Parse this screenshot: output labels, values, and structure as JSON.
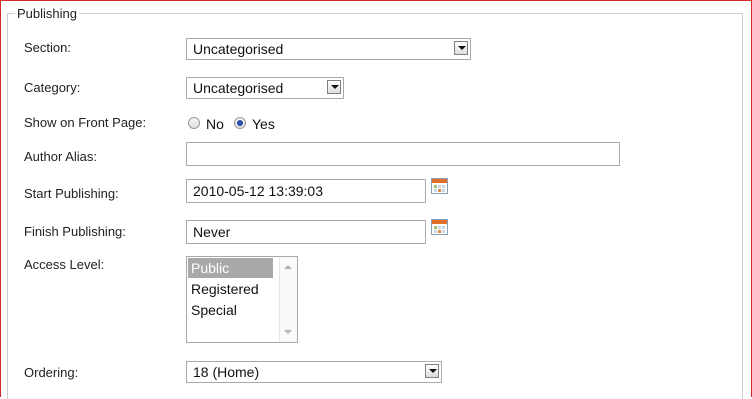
{
  "fieldset": {
    "legend": "Publishing"
  },
  "fields": {
    "section": {
      "label": "Section:",
      "value": "Uncategorised"
    },
    "category": {
      "label": "Category:",
      "value": "Uncategorised"
    },
    "front_page": {
      "label": "Show on Front Page:",
      "options": [
        "No",
        "Yes"
      ],
      "selected": "Yes"
    },
    "author_alias": {
      "label": "Author Alias:",
      "value": ""
    },
    "start_publishing": {
      "label": "Start Publishing:",
      "value": "2010-05-12 13:39:03"
    },
    "finish_publishing": {
      "label": "Finish Publishing:",
      "value": "Never"
    },
    "access_level": {
      "label": "Access Level:",
      "options": [
        "Public",
        "Registered",
        "Special"
      ],
      "selected": "Public"
    },
    "ordering": {
      "label": "Ordering:",
      "value": "18 (Home)"
    }
  },
  "icons": {
    "calendar": "calendar-icon",
    "dropdown": "chevron-down-icon"
  },
  "colors": {
    "outer_border": "#d42a2a",
    "selected_option_bg": "#a9a9a9",
    "radio_dot": "#2a4ea8"
  }
}
